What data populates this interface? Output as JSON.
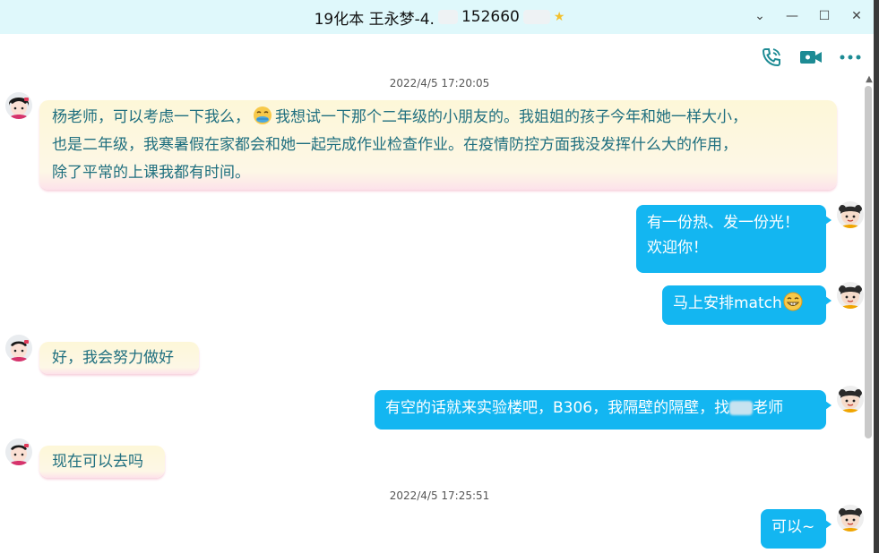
{
  "titlebar": {
    "title_part1": "19化本 王永梦-4.",
    "title_part2": "152660",
    "star": "★",
    "minimize": "—",
    "dropdown": "⌄",
    "maximize": "☐",
    "close": "✕"
  },
  "colors": {
    "titlebar_bg": "#dff8fb",
    "outgoing_bubble": "#13b6f1",
    "incoming_text": "#1f6f7f",
    "icon_teal": "#1d8b94"
  },
  "timestamps": [
    "2022/4/5 17:20:05",
    "2022/4/5 17:25:51"
  ],
  "messages": {
    "m1_a": "杨老师，可以考虑一下我么，",
    "m1_b": "我想试一下那个二年级的小朋友的。我姐姐的孩子今年和她一样大小，",
    "m1_c": "也是二年级，我寒暑假在家都会和她一起完成作业检查作业。在疫情防控方面我没发挥什么大的作用，",
    "m1_d": "除了平常的上课我都有时间。",
    "m2_a": "有一份热、发一份光！",
    "m2_b": "欢迎你！",
    "m3": "马上安排match",
    "m4": "好，我会努力做好",
    "m5_a": "有空的话就来实验楼吧，B306，我隔壁的隔壁，找",
    "m5_b": "老师",
    "m6": "现在可以去吗",
    "m7": "可以~"
  },
  "icons": [
    "phone-icon",
    "video-call-icon",
    "more-icon",
    "star-icon",
    "emoji-icon",
    "grin-emoji-icon"
  ]
}
